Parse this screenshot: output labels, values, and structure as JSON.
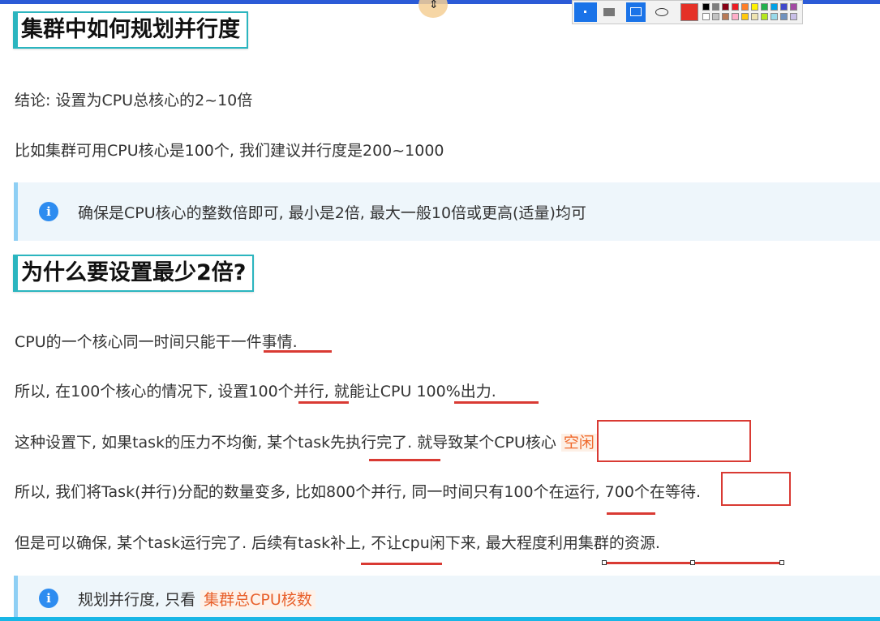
{
  "heading1": "集群中如何规划并行度",
  "p_conclusion": "结论: 设置为CPU总核心的2~10倍",
  "p_example": "比如集群可用CPU核心是100个, 我们建议并行度是200~1000",
  "callout1": "确保是CPU核心的整数倍即可, 最小是2倍, 最大一般10倍或更高(适量)均可",
  "heading2": "为什么要设置最少2倍?",
  "p1": "CPU的一个核心同一时间只能干一件事情.",
  "p2": "所以, 在100个核心的情况下, 设置100个并行, 就能让CPU 100%出力.",
  "p3_text": "这种设置下, 如果task的压力不均衡, 某个task先执行完了. 就导致某个CPU核心",
  "p3_highlight": "空闲",
  "p4": "所以, 我们将Task(并行)分配的数量变多, 比如800个并行, 同一时间只有100个在运行, 700个在等待.",
  "p5": "但是可以确保, 某个task运行完了. 后续有task补上, 不让cpu闲下来, 最大程度利用集群的资源.",
  "callout2_prefix": "规划并行度, 只看",
  "callout2_highlight": "集群总CPU核数",
  "colors": {
    "heading_border": "#2bb5bf",
    "callout_bg": "#eef6fb",
    "callout_bar": "#8ecff4",
    "info_icon": "#2d8cf0",
    "annotation_red": "#d93a33",
    "highlight_orange": "#f06a2d",
    "top_bar": "#2b5bd7",
    "bottom_bar": "#18b6e6"
  },
  "toolbar_palette": [
    "#000000",
    "#7f7f7f",
    "#880015",
    "#ed1c24",
    "#ff7f27",
    "#fff200",
    "#22b14c",
    "#00a2e8",
    "#3f48cc",
    "#a349a4",
    "#ffffff",
    "#c3c3c3",
    "#b97a57",
    "#ffaec9",
    "#ffc90e",
    "#efe4b0",
    "#b5e61d",
    "#99d9ea",
    "#7092be",
    "#c8bfe7"
  ]
}
